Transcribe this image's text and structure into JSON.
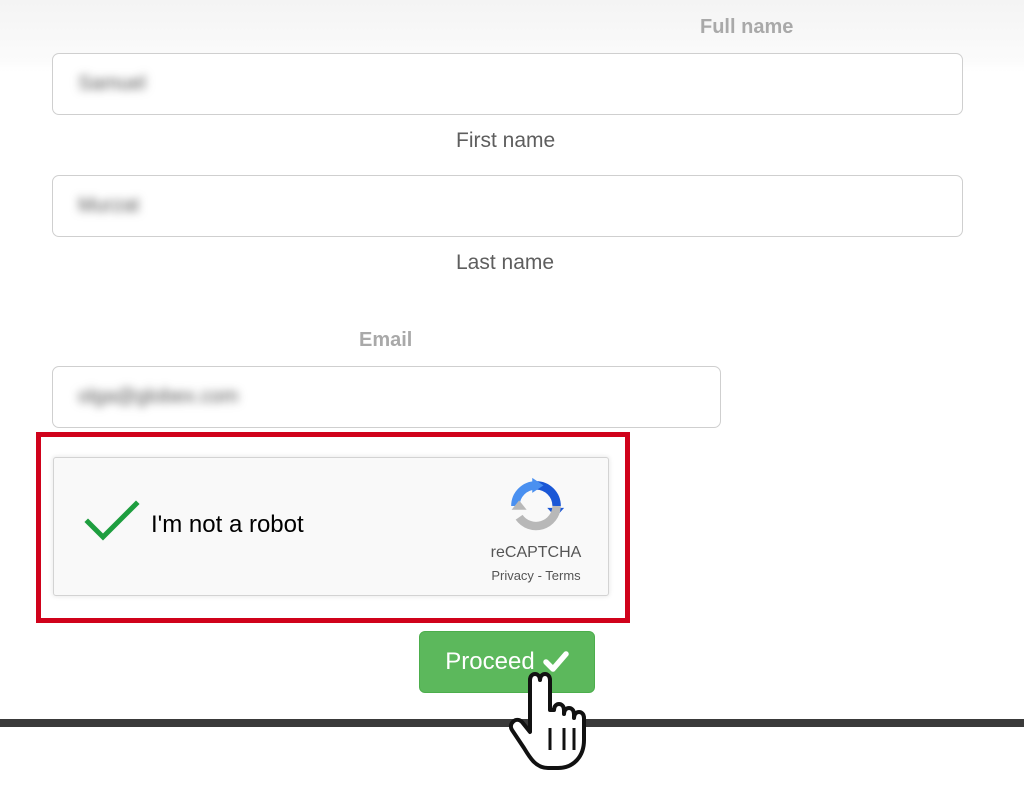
{
  "form": {
    "full_name": {
      "heading": "Full name",
      "first": {
        "value": "Samuel",
        "label": "First name"
      },
      "last": {
        "value": "Murzat",
        "label": "Last name"
      }
    },
    "email": {
      "heading": "Email",
      "value": "olga@globex.com"
    }
  },
  "captcha": {
    "status_icon": "checkmark-icon",
    "label": "I'm not a robot",
    "brand": "reCAPTCHA",
    "privacy": "Privacy",
    "separator": "-",
    "terms": "Terms",
    "check_color": "#1e9e3f"
  },
  "actions": {
    "proceed_label": "Proceed",
    "proceed_icon": "checkmark-icon",
    "button_color": "#5cb85c"
  },
  "annotations": {
    "highlight_color": "#d0021b",
    "cursor_icon": "hand-pointer-icon"
  }
}
